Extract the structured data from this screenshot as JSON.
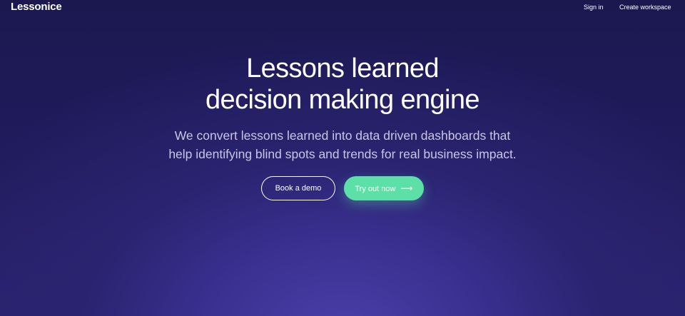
{
  "header": {
    "logo_text": "Lessonice",
    "nav": {
      "sign_in": "Sign in",
      "create_workspace": "Create workspace"
    }
  },
  "hero": {
    "title_line1": "Lessons learned",
    "title_line2": "decision making engine",
    "subtitle_line1": "We convert lessons learned into data driven dashboards that",
    "subtitle_line2": "help identifying blind spots and trends for real business impact.",
    "book_demo_label": "Book a demo",
    "try_out_label": "Try out now",
    "try_out_icon": "arrow-right-icon"
  },
  "colors": {
    "background_top": "#1b1850",
    "background_glow": "#4a3fa8",
    "accent_green": "#5de0a8",
    "text_white": "#ffffff",
    "subtitle_text": "#c9c6e6"
  }
}
